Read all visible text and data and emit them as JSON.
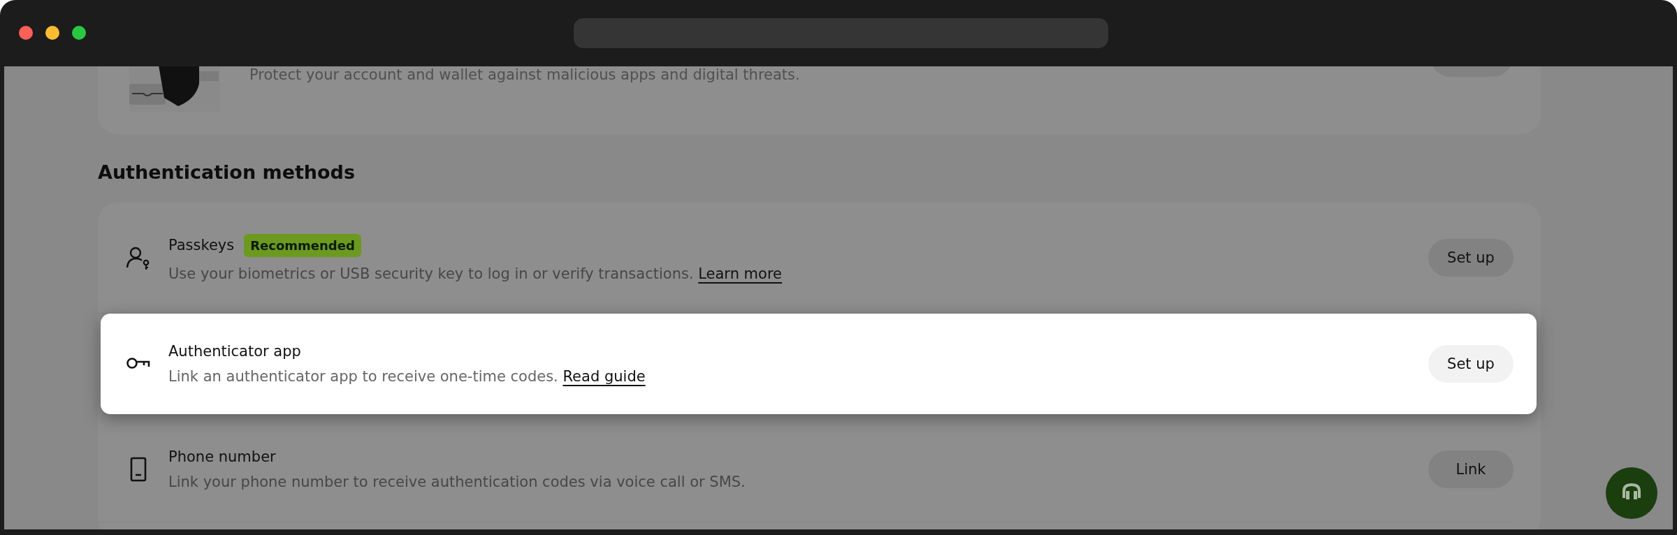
{
  "top_card": {
    "description": "Protect your account and wallet against malicious apps and digital threats.",
    "kind": "picture"
  },
  "section": {
    "title": "Authentication methods"
  },
  "methods": [
    {
      "kind": "passkey",
      "title": "Passkeys",
      "badge": "Recommended",
      "description": "Use your biometrics or USB security key to log in or verify transactions.",
      "link": "Learn more",
      "button": "Set up",
      "highlighted": false
    },
    {
      "kind": "key",
      "title": "Authenticator app",
      "description": "Link an authenticator app to receive one-time codes.",
      "link": "Read guide",
      "button": "Set up",
      "highlighted": true
    },
    {
      "kind": "phone",
      "title": "Phone number",
      "description": "Link your phone number to receive authentication codes via voice call or SMS.",
      "button": "Link",
      "highlighted": false
    }
  ]
}
